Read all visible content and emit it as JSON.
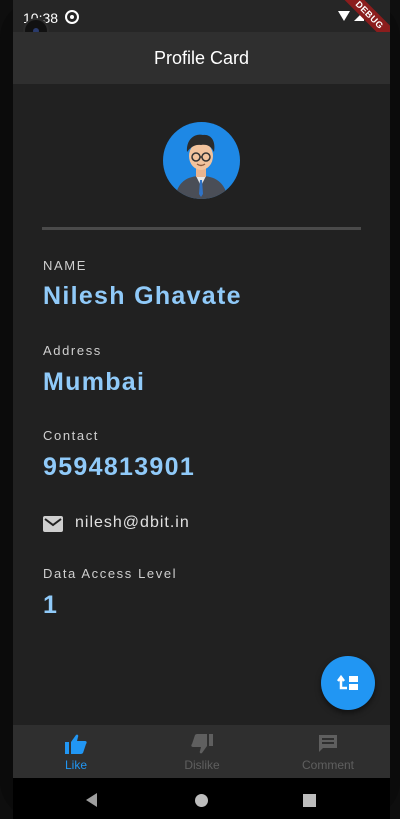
{
  "status_bar": {
    "time": "10:38",
    "debug_banner": "DEBUG"
  },
  "app_bar": {
    "title": "Profile Card"
  },
  "profile": {
    "name_label": "NAME",
    "name": "Nilesh Ghavate",
    "address_label": "Address",
    "address": "Mumbai",
    "contact_label": "Contact",
    "contact": "9594813901",
    "email": "nilesh@dbit.in",
    "access_label": "Data Access Level",
    "access_level": "1"
  },
  "bottom_nav": {
    "items": [
      {
        "label": "Like",
        "icon": "thumb-up-icon",
        "active": true
      },
      {
        "label": "Dislike",
        "icon": "thumb-down-icon",
        "active": false
      },
      {
        "label": "Comment",
        "icon": "comment-icon",
        "active": false
      }
    ]
  },
  "colors": {
    "accent": "#2196f3",
    "value_text": "#90caf9",
    "surface": "#212121",
    "appbar": "#2f2f2f"
  }
}
